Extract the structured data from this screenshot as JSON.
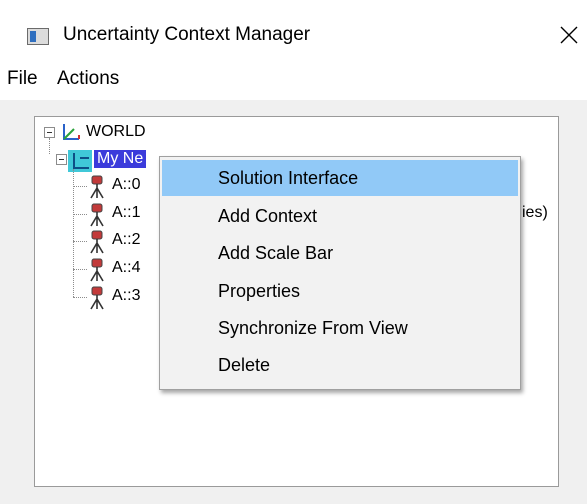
{
  "window": {
    "title": "Uncertainty Context Manager",
    "close_glyph": "✕"
  },
  "menu": [
    "File",
    "Actions"
  ],
  "tree": {
    "root": {
      "label": "WORLD",
      "icon": "axes-icon"
    },
    "network": {
      "label": "My Ne",
      "icon": "network-icon",
      "selected": true
    },
    "stations": [
      {
        "label": "A::0",
        "icon": "tripod-instrument-icon"
      },
      {
        "label": "A::1",
        "icon": "tripod-instrument-icon"
      },
      {
        "label": "A::2",
        "icon": "tripod-instrument-icon"
      },
      {
        "label": "A::4",
        "icon": "tripod-instrument-icon"
      },
      {
        "label": "A::3",
        "icon": "tripod-instrument-icon"
      }
    ],
    "obscured_suffix": "ies)"
  },
  "context_menu": {
    "items": [
      "Solution Interface",
      "Add Context",
      "Add Scale Bar",
      "Properties",
      "Synchronize From View",
      "Delete"
    ],
    "highlighted": "Solution Interface"
  },
  "colors": {
    "selection": "#3b3bdb",
    "menu_highlight": "#91c9f7"
  }
}
